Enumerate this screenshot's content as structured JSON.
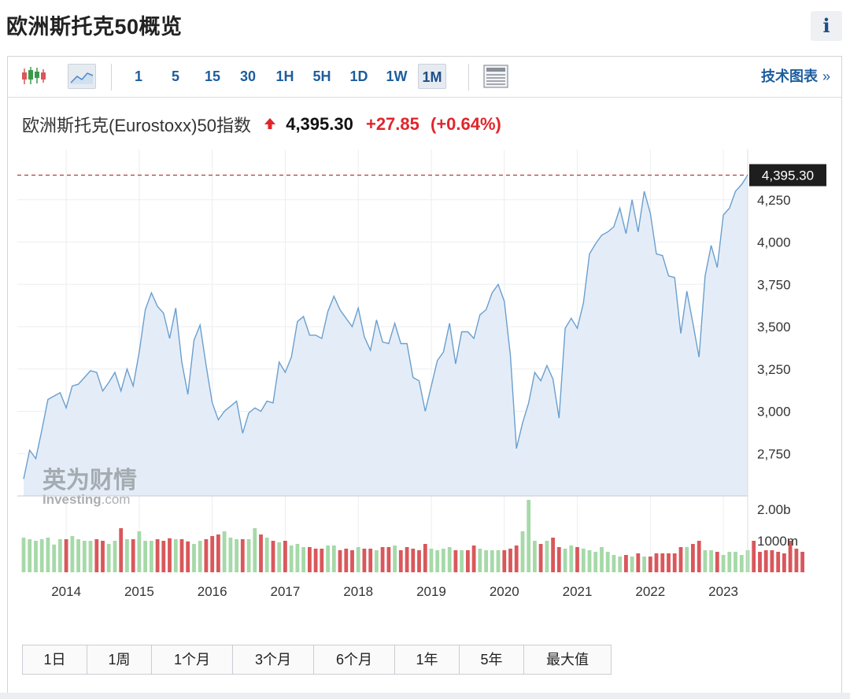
{
  "page": {
    "title": "欧洲斯托克50概览",
    "info_label": "i"
  },
  "toolbar": {
    "timeframes": [
      "1",
      "5",
      "15",
      "30",
      "1H",
      "5H",
      "1D",
      "1W",
      "1M"
    ],
    "active_timeframe": "1M",
    "tech_link": "技术图表",
    "tech_link_chevron": "»",
    "icons": [
      "candlestick-icon",
      "line-chart-icon",
      "table-view-icon"
    ]
  },
  "quote": {
    "name": "欧洲斯托克(Eurostoxx)50指数",
    "price": "4,395.30",
    "change": "+27.85",
    "change_pct": "(+0.64%)",
    "up_color": "#e0262b"
  },
  "watermark": {
    "cn": "英为财情",
    "en": "Investing",
    "suffix": ".com"
  },
  "ranges": [
    "1日",
    "1周",
    "1个月",
    "3个月",
    "6个月",
    "1年",
    "5年",
    "最大值"
  ],
  "colors": {
    "line": "#6a9fcf",
    "area": "#e4edf7",
    "vol_up": "#a6d9a8",
    "vol_down": "#d9575b",
    "last_price_label_bg": "#1e1e1e",
    "last_price_line": "#b53a3a"
  },
  "chart_data": {
    "type": "line",
    "x": [
      "2013-06",
      "2013-07",
      "2013-08",
      "2013-09",
      "2013-10",
      "2013-11",
      "2013-12",
      "2014-01",
      "2014-02",
      "2014-03",
      "2014-04",
      "2014-05",
      "2014-06",
      "2014-07",
      "2014-08",
      "2014-09",
      "2014-10",
      "2014-11",
      "2014-12",
      "2015-01",
      "2015-02",
      "2015-03",
      "2015-04",
      "2015-05",
      "2015-06",
      "2015-07",
      "2015-08",
      "2015-09",
      "2015-10",
      "2015-11",
      "2015-12",
      "2016-01",
      "2016-02",
      "2016-03",
      "2016-04",
      "2016-05",
      "2016-06",
      "2016-07",
      "2016-08",
      "2016-09",
      "2016-10",
      "2016-11",
      "2016-12",
      "2017-01",
      "2017-02",
      "2017-03",
      "2017-04",
      "2017-05",
      "2017-06",
      "2017-07",
      "2017-08",
      "2017-09",
      "2017-10",
      "2017-11",
      "2017-12",
      "2018-01",
      "2018-02",
      "2018-03",
      "2018-04",
      "2018-05",
      "2018-06",
      "2018-07",
      "2018-08",
      "2018-09",
      "2018-10",
      "2018-11",
      "2018-12",
      "2019-01",
      "2019-02",
      "2019-03",
      "2019-04",
      "2019-05",
      "2019-06",
      "2019-07",
      "2019-08",
      "2019-09",
      "2019-10",
      "2019-11",
      "2019-12",
      "2020-01",
      "2020-02",
      "2020-03",
      "2020-04",
      "2020-05",
      "2020-06",
      "2020-07",
      "2020-08",
      "2020-09",
      "2020-10",
      "2020-11",
      "2020-12",
      "2021-01",
      "2021-02",
      "2021-03",
      "2021-04",
      "2021-05",
      "2021-06",
      "2021-07",
      "2021-08",
      "2021-09",
      "2021-10",
      "2021-11",
      "2021-12",
      "2022-01",
      "2022-02",
      "2022-03",
      "2022-04",
      "2022-05",
      "2022-06",
      "2022-07",
      "2022-08",
      "2022-09",
      "2022-10",
      "2022-11",
      "2022-12",
      "2023-01",
      "2023-02",
      "2023-03",
      "2023-04",
      "2023-05"
    ],
    "values": [
      2600,
      2770,
      2720,
      2890,
      3070,
      3090,
      3110,
      3020,
      3150,
      3160,
      3200,
      3240,
      3230,
      3120,
      3170,
      3230,
      3120,
      3250,
      3150,
      3350,
      3600,
      3700,
      3620,
      3580,
      3430,
      3610,
      3290,
      3100,
      3420,
      3510,
      3270,
      3050,
      2950,
      3000,
      3030,
      3060,
      2870,
      2990,
      3020,
      3000,
      3060,
      3050,
      3290,
      3230,
      3320,
      3530,
      3560,
      3450,
      3450,
      3430,
      3590,
      3680,
      3600,
      3550,
      3500,
      3610,
      3440,
      3360,
      3540,
      3410,
      3400,
      3520,
      3400,
      3400,
      3200,
      3180,
      3000,
      3150,
      3300,
      3350,
      3520,
      3280,
      3470,
      3470,
      3430,
      3570,
      3600,
      3700,
      3750,
      3650,
      3330,
      2780,
      2930,
      3050,
      3230,
      3180,
      3270,
      3190,
      2960,
      3490,
      3550,
      3490,
      3640,
      3930,
      3990,
      4040,
      4060,
      4090,
      4200,
      4050,
      4250,
      4060,
      4300,
      4170,
      3930,
      3920,
      3800,
      3790,
      3460,
      3710,
      3520,
      3320,
      3800,
      3980,
      3850,
      4160,
      4200,
      4300,
      4340,
      4395.3
    ],
    "volumes": [
      1100,
      1050,
      1000,
      1050,
      1100,
      880,
      1050,
      1050,
      1150,
      1050,
      1000,
      1000,
      1050,
      1000,
      900,
      1000,
      1400,
      1050,
      1050,
      1300,
      1000,
      1000,
      1050,
      1000,
      1080,
      1050,
      1050,
      980,
      900,
      1000,
      1050,
      1150,
      1200,
      1300,
      1100,
      1050,
      1050,
      1050,
      1400,
      1200,
      1100,
      1000,
      950,
      1000,
      850,
      900,
      800,
      800,
      750,
      750,
      850,
      850,
      700,
      750,
      700,
      800,
      750,
      750,
      700,
      800,
      800,
      850,
      700,
      800,
      750,
      700,
      900,
      750,
      700,
      750,
      800,
      700,
      700,
      700,
      850,
      750,
      700,
      700,
      700,
      700,
      750,
      850,
      1300,
      2300,
      1000,
      900,
      1000,
      1100,
      800,
      750,
      850,
      800,
      750,
      700,
      650,
      800,
      650,
      550,
      500,
      550,
      500,
      600,
      500,
      500,
      600,
      600,
      600,
      600,
      800,
      800,
      900,
      1000,
      700,
      700,
      650,
      550,
      650,
      650,
      550,
      700,
      1000,
      650,
      700,
      700,
      650,
      600,
      1000,
      750,
      650
    ],
    "vol_up": [
      true,
      true,
      true,
      true,
      true,
      true,
      true,
      false,
      true,
      true,
      true,
      true,
      false,
      false,
      true,
      true,
      false,
      true,
      false,
      true,
      true,
      true,
      false,
      false,
      false,
      true,
      false,
      false,
      true,
      true,
      false,
      false,
      false,
      true,
      true,
      true,
      false,
      true,
      true,
      false,
      true,
      false,
      true,
      false,
      true,
      true,
      true,
      false,
      false,
      false,
      true,
      true,
      false,
      false,
      false,
      true,
      false,
      false,
      true,
      false,
      false,
      true,
      false,
      false,
      false,
      false,
      false,
      true,
      true,
      true,
      true,
      false,
      true,
      false,
      false,
      true,
      true,
      true,
      true,
      false,
      false,
      false,
      true,
      true,
      true,
      false,
      true,
      false,
      false,
      true,
      true,
      false,
      true,
      true,
      true,
      true,
      true,
      true,
      true,
      false,
      true,
      false,
      true,
      false,
      false,
      false,
      false,
      false,
      false,
      true,
      false,
      false,
      true,
      true,
      false,
      true,
      true,
      true,
      true,
      true
    ],
    "x_ticks": [
      "2014",
      "2015",
      "2016",
      "2017",
      "2018",
      "2019",
      "2020",
      "2021",
      "2022",
      "2023"
    ],
    "y_ticks": [
      2750,
      3000,
      3250,
      3500,
      3750,
      4000,
      4250
    ],
    "y_tick_labels": [
      "2,750",
      "3,000",
      "3,250",
      "3,500",
      "3,750",
      "4,000",
      "4,250"
    ],
    "ylim": [
      2500,
      4500
    ],
    "volume_tick_labels": [
      "2.00b",
      "1000m"
    ],
    "volume_ticks": [
      2000,
      1000
    ],
    "volume_max": 2500,
    "last_value_label": "4,395.30",
    "xlabel": "",
    "ylabel": "",
    "grid": true
  }
}
